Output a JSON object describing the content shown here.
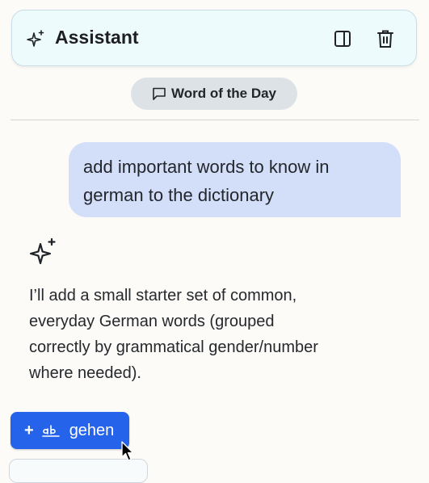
{
  "header": {
    "title": "Assistant",
    "icons": [
      "sparkles-icon",
      "sidebar-toggle-icon",
      "trash-icon"
    ]
  },
  "chip": {
    "icon": "message-square-icon",
    "label": "Word of the Day"
  },
  "user_message": "add important words to know in german to the dictionary",
  "assistant": {
    "icon": "sparkles-icon",
    "message": "I’ll add a small starter set of common, everyday German words (grouped correctly by grammatical gender/number where needed)."
  },
  "action_button": {
    "plus": "+",
    "icon": "text-ab-icon",
    "label": "gehen"
  },
  "colors": {
    "accent": "#2563eb",
    "user_bubble": "#d3def8",
    "header_bg": "#eefbfd"
  }
}
